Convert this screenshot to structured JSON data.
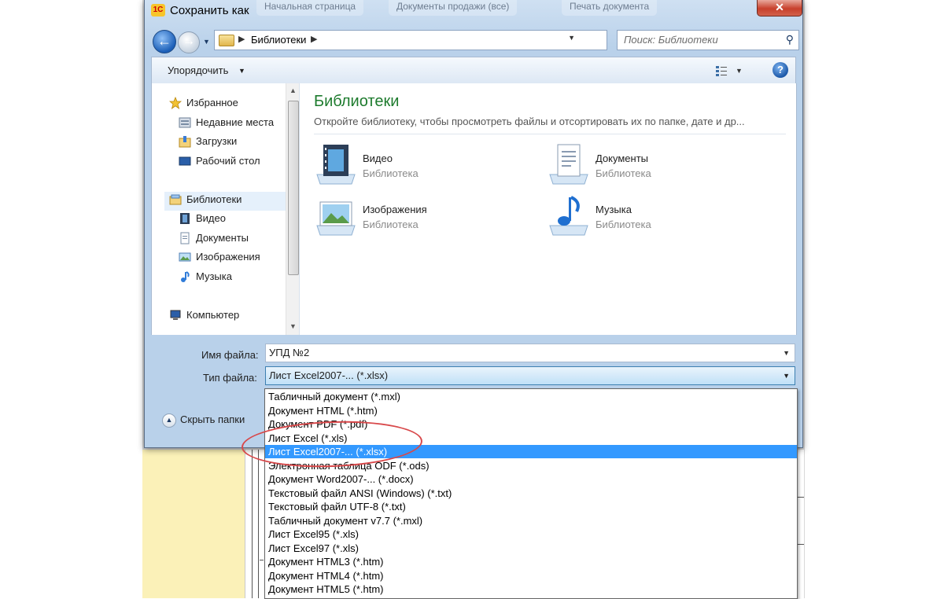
{
  "window": {
    "title": "Сохранить как",
    "close_label": "✕",
    "background_tabs": [
      "Начальная страница",
      "Документы продажи (все)",
      "Печать документа"
    ]
  },
  "nav": {
    "address_path": "Библиотеки",
    "search_placeholder": "Поиск: Библиотеки"
  },
  "toolbar": {
    "organize_label": "Упорядочить",
    "help_label": "?"
  },
  "sidebar": {
    "items": [
      {
        "label": "Избранное",
        "icon": "star-icon"
      },
      {
        "label": "Недавние места",
        "icon": "recent-places-icon"
      },
      {
        "label": "Загрузки",
        "icon": "downloads-icon"
      },
      {
        "label": "Рабочий стол",
        "icon": "desktop-icon"
      },
      {
        "label": "Библиотеки",
        "icon": "libraries-icon"
      },
      {
        "label": "Видео",
        "icon": "video-icon"
      },
      {
        "label": "Документы",
        "icon": "documents-icon"
      },
      {
        "label": "Изображения",
        "icon": "pictures-icon"
      },
      {
        "label": "Музыка",
        "icon": "music-icon"
      },
      {
        "label": "Компьютер",
        "icon": "computer-icon"
      }
    ]
  },
  "content": {
    "title": "Библиотеки",
    "description": "Откройте библиотеку, чтобы просмотреть файлы и отсортировать их по папке, дате и др...",
    "libraries": [
      {
        "name": "Видео",
        "kind": "Библиотека",
        "icon": "video-library-icon"
      },
      {
        "name": "Документы",
        "kind": "Библиотека",
        "icon": "documents-library-icon"
      },
      {
        "name": "Изображения",
        "kind": "Библиотека",
        "icon": "pictures-library-icon"
      },
      {
        "name": "Музыка",
        "kind": "Библиотека",
        "icon": "music-library-icon"
      }
    ]
  },
  "form": {
    "filename_label": "Имя файла:",
    "filename_value": "УПД №2",
    "filetype_label": "Тип файла:",
    "filetype_value": "Лист Excel2007-... (*.xlsx)",
    "hide_folders_label": "Скрыть папки"
  },
  "filetype_options": [
    "Табличный документ (*.mxl)",
    "Документ HTML (*.htm)",
    "Документ PDF (*.pdf)",
    "Лист Excel (*.xls)",
    "Лист Excel2007-... (*.xlsx)",
    "Электронная таблица ODF (*.ods)",
    "Документ Word2007-... (*.docx)",
    "Текстовый файл ANSI (Windows) (*.txt)",
    "Текстовый файл UTF-8 (*.txt)",
    "Табличный документ v7.7 (*.mxl)",
    "Лист Excel95 (*.xls)",
    "Лист Excel97 (*.xls)",
    "Документ HTML3 (*.htm)",
    "Документ HTML4 (*.htm)",
    "Документ HTML5 (*.htm)"
  ],
  "selected_option_index": 4,
  "colors": {
    "accent_title": "#1e7b2e",
    "selection": "#3399ff",
    "annotation": "#d8484a"
  }
}
